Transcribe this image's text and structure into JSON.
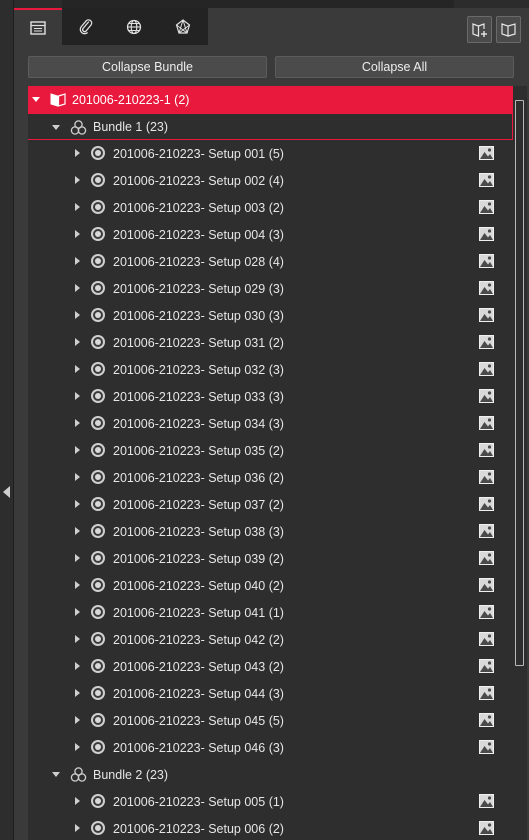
{
  "tabs": [
    {
      "name": "tab-project",
      "icon": "project-list-icon",
      "active": true
    },
    {
      "name": "tab-attachments",
      "icon": "paperclip-icon",
      "active": false
    },
    {
      "name": "tab-web",
      "icon": "globe-icon",
      "active": false
    },
    {
      "name": "tab-network",
      "icon": "network-icon",
      "active": false
    }
  ],
  "toolbar": {
    "add_icon": "book-add-icon",
    "open_icon": "book-open-icon"
  },
  "buttons": {
    "collapse_bundle": "Collapse Bundle",
    "collapse_all": "Collapse All"
  },
  "tree": {
    "root": {
      "label": "201006-210223-1 (2)",
      "icon": "project-book-icon",
      "expanded": true,
      "selected": true
    },
    "bundles": [
      {
        "label": "Bundle 1 (23)",
        "icon": "bundle-icon",
        "expanded": true,
        "setups": [
          "201006-210223- Setup 001 (5)",
          "201006-210223- Setup 002 (4)",
          "201006-210223- Setup 003 (2)",
          "201006-210223- Setup 004 (3)",
          "201006-210223- Setup 028 (4)",
          "201006-210223- Setup 029 (3)",
          "201006-210223- Setup 030 (3)",
          "201006-210223- Setup 031 (2)",
          "201006-210223- Setup 032 (3)",
          "201006-210223- Setup 033 (3)",
          "201006-210223- Setup 034 (3)",
          "201006-210223- Setup 035 (2)",
          "201006-210223- Setup 036 (2)",
          "201006-210223- Setup 037 (2)",
          "201006-210223- Setup 038 (3)",
          "201006-210223- Setup 039 (2)",
          "201006-210223- Setup 040 (2)",
          "201006-210223- Setup 041 (1)",
          "201006-210223- Setup 042 (2)",
          "201006-210223- Setup 043 (2)",
          "201006-210223- Setup 044 (3)",
          "201006-210223- Setup 045 (5)",
          "201006-210223- Setup 046 (3)"
        ]
      },
      {
        "label": "Bundle 2 (23)",
        "icon": "bundle-icon",
        "expanded": true,
        "setups": [
          "201006-210223- Setup 005 (1)",
          "201006-210223- Setup 006 (2)"
        ]
      }
    ]
  },
  "colors": {
    "accent": "#e8193c",
    "panel": "#3a3a3a",
    "tree_bg": "#2e2e2e"
  }
}
